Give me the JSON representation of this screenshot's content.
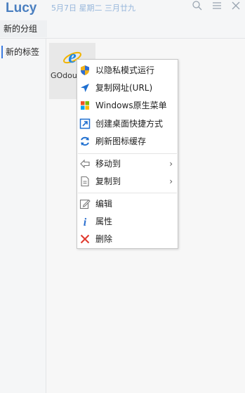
{
  "app": {
    "title": "Lucy",
    "date": "5月7日 星期二 三月廿九"
  },
  "titlebar": {
    "icons": [
      "search-icon",
      "menu-icon",
      "close-icon"
    ]
  },
  "groups": {
    "active": "新的分组"
  },
  "sidebar": {
    "items": [
      {
        "label": "新的标签"
      }
    ]
  },
  "tile": {
    "label": "GOdou",
    "icon": "internet-explorer-icon"
  },
  "context_menu": {
    "items": [
      {
        "label": "以隐私模式运行",
        "icon": "shield-icon"
      },
      {
        "label": "复制网址(URL)",
        "icon": "send-arrow-icon"
      },
      {
        "label": "Windows原生菜单",
        "icon": "windows-logo-icon"
      },
      {
        "label": "创建桌面快捷方式",
        "icon": "shortcut-icon"
      },
      {
        "label": "刷新图标缓存",
        "icon": "refresh-icon"
      },
      {
        "label": "移动到",
        "icon": "move-icon",
        "submenu": "›"
      },
      {
        "label": "复制到",
        "icon": "copy-icon",
        "submenu": "›"
      },
      {
        "label": "编辑",
        "icon": "edit-icon"
      },
      {
        "label": "属性",
        "icon": "info-icon"
      },
      {
        "label": "删除",
        "icon": "delete-icon"
      }
    ]
  },
  "colors": {
    "accent": "#3c7be0",
    "title": "#4a7fc0",
    "delete": "#e03a2f",
    "info": "#2b6fcf"
  }
}
